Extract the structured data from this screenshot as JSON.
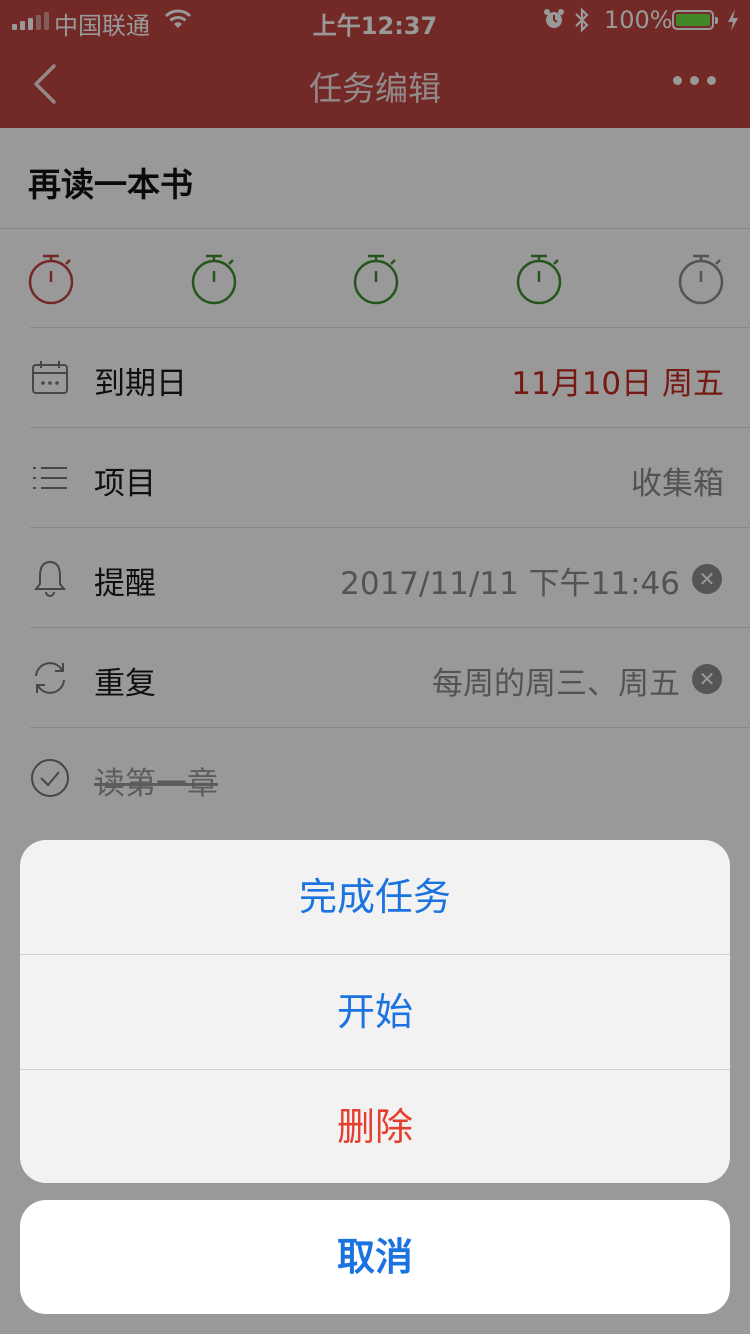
{
  "status_bar": {
    "carrier": "中国联通",
    "time": "上午12:37",
    "battery": "100%"
  },
  "nav": {
    "title": "任务编辑"
  },
  "task": {
    "title": "再读一本书",
    "pomodoros": [
      {
        "icon": "stopwatch-icon",
        "color": "#c0453f"
      },
      {
        "icon": "stopwatch-icon",
        "color": "#3e8e2f"
      },
      {
        "icon": "stopwatch-icon",
        "color": "#3e8e2f"
      },
      {
        "icon": "stopwatch-icon",
        "color": "#3e8e2f"
      },
      {
        "icon": "stopwatch-icon",
        "color": "#8a8a8a"
      }
    ],
    "rows": {
      "due": {
        "icon": "calendar-icon",
        "label": "到期日",
        "value": "11月10日 周五"
      },
      "project": {
        "icon": "list-icon",
        "label": "项目",
        "value": "收集箱"
      },
      "reminder": {
        "icon": "bell-icon",
        "label": "提醒",
        "value": "2017/11/11 下午11:46"
      },
      "repeat": {
        "icon": "repeat-icon",
        "label": "重复",
        "value": "每周的周三、周五"
      }
    },
    "subtask": {
      "icon": "check-circle-icon",
      "label": "读第一章",
      "completed": true
    }
  },
  "action_sheet": {
    "items": [
      "完成任务",
      "开始",
      "删除"
    ],
    "cancel": "取消"
  },
  "colors": {
    "brand": "#c0453f",
    "action_blue": "#1a73e0",
    "danger_red": "#e5402f",
    "due_red": "#c42a1f"
  }
}
